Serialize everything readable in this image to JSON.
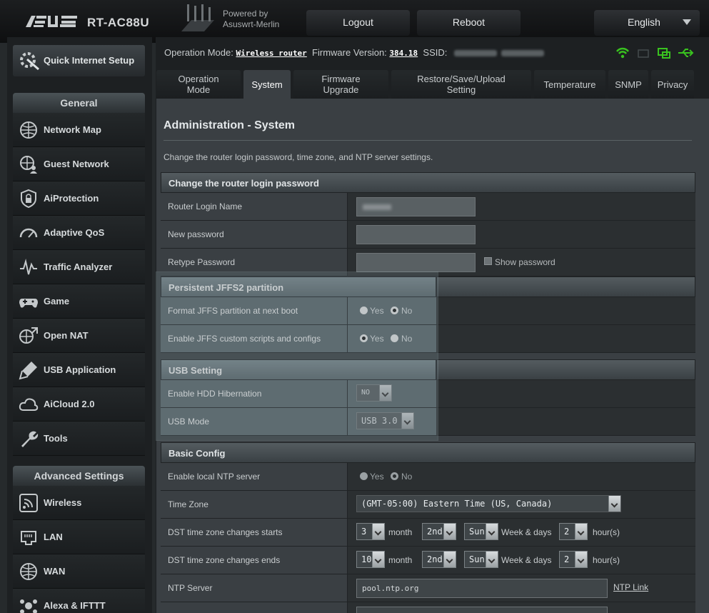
{
  "header": {
    "brand": "ASUS",
    "model": "RT-AC88U",
    "powered_line1": "Powered by",
    "powered_line2": "Asuswrt-Merlin",
    "logout_label": "Logout",
    "reboot_label": "Reboot",
    "language": "English"
  },
  "status": {
    "op_mode_label": "Operation Mode:",
    "op_mode_value": "Wireless router",
    "fw_label": "Firmware Version:",
    "fw_value": "384.18",
    "ssid_label": "SSID:"
  },
  "sidebar": {
    "quick_setup": "Quick Internet Setup",
    "general_title": "General",
    "general_items": [
      "Network Map",
      "Guest Network",
      "AiProtection",
      "Adaptive QoS",
      "Traffic Analyzer",
      "Game",
      "Open NAT",
      "USB Application",
      "AiCloud 2.0",
      "Tools"
    ],
    "advanced_title": "Advanced Settings",
    "advanced_items": [
      "Wireless",
      "LAN",
      "WAN",
      "Alexa & IFTTT"
    ]
  },
  "tabs": {
    "operation_mode_1": "Operation",
    "operation_mode_2": "Mode",
    "system": "System",
    "firmware_1": "Firmware",
    "firmware_2": "Upgrade",
    "restore_1": "Restore/Save/Upload",
    "restore_2": "Setting",
    "temperature": "Temperature",
    "snmp": "SNMP",
    "privacy": "Privacy"
  },
  "page": {
    "title": "Administration - System",
    "description": "Change the router login password, time zone, and NTP server settings."
  },
  "password_section": {
    "title": "Change the router login password",
    "login_name_label": "Router Login Name",
    "new_password_label": "New password",
    "retype_label": "Retype Password",
    "show_password": "Show password"
  },
  "jffs_section": {
    "title": "Persistent JFFS2 partition",
    "format_label": "Format JFFS partition at next boot",
    "scripts_label": "Enable JFFS custom scripts and configs",
    "yes": "Yes",
    "no": "No"
  },
  "usb_section": {
    "title": "USB Setting",
    "hibernation_label": "Enable HDD Hibernation",
    "hibernation_value": "NO",
    "usb_mode_label": "USB Mode",
    "usb_mode_value": "USB 3.0"
  },
  "basic_section": {
    "title": "Basic Config",
    "ntp_server_enable_label": "Enable local NTP server",
    "yes": "Yes",
    "no": "No",
    "timezone_label": "Time Zone",
    "timezone_value": "(GMT-05:00) Eastern Time (US, Canada)",
    "dst_start_label": "DST time zone changes starts",
    "dst_start_month": "3",
    "dst_start_week": "2nd",
    "dst_start_day": "Sun",
    "dst_start_hour": "2",
    "dst_end_label": "DST time zone changes ends",
    "dst_end_month": "10",
    "dst_end_week": "2nd",
    "dst_end_day": "Sun",
    "dst_end_hour": "2",
    "month_unit": "month",
    "week_unit": "Week & days",
    "hour_unit": "hour(s)",
    "ntp_server_label": "NTP Server",
    "ntp_server_value": "pool.ntp.org",
    "ntp_link": "NTP Link"
  }
}
